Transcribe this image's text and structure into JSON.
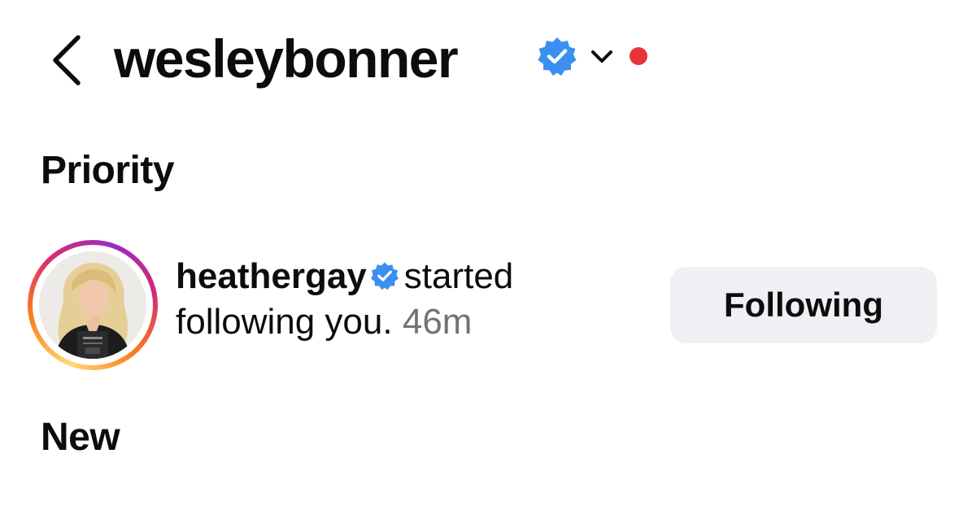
{
  "header": {
    "username": "wesleybonner",
    "verified_icon": "verified-badge-icon",
    "back_icon": "chevron-left-icon",
    "dropdown_icon": "chevron-down-icon",
    "unread_dot_color": "#e8333a"
  },
  "sections": {
    "priority_title": "Priority",
    "new_title": "New"
  },
  "notification": {
    "username": "heathergay",
    "verified": true,
    "text_line1": "started",
    "text_line2": "following you.",
    "timestamp": "46m",
    "button_label": "Following",
    "avatar_icon": "profile-photo"
  },
  "colors": {
    "verified_blue": "#3b8ff0",
    "text_primary": "#0c0c0c",
    "text_secondary": "#737373",
    "button_bg": "#efeff4"
  }
}
